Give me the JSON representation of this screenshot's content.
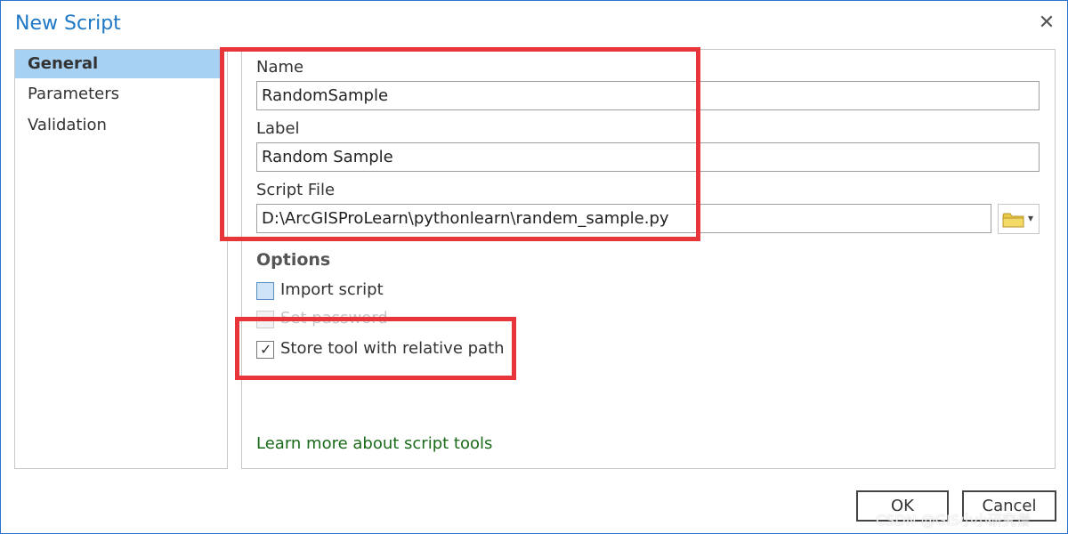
{
  "window": {
    "title": "New Script",
    "close_label": "✕"
  },
  "nav": {
    "items": [
      {
        "label": "General",
        "selected": true
      },
      {
        "label": "Parameters",
        "selected": false
      },
      {
        "label": "Validation",
        "selected": false
      }
    ]
  },
  "general": {
    "name_label": "Name",
    "name_value": "RandomSample",
    "label_label": "Label",
    "label_value": "Random Sample",
    "script_file_label": "Script File",
    "script_file_value": "D:\\ArcGISProLearn\\pythonlearn\\randem_sample.py",
    "browse_icon": "folder-icon",
    "browse_dropdown": "▾"
  },
  "options": {
    "heading": "Options",
    "import_script": {
      "label": "Import script",
      "checked": false
    },
    "set_password": {
      "label": "Set password",
      "checked": false,
      "disabled": true
    },
    "store_relative": {
      "label": "Store tool with relative path",
      "checked": true
    }
  },
  "check_mark": "✓",
  "learn_more": "Learn more about script tools",
  "buttons": {
    "ok": "OK",
    "cancel": "Cancel"
  },
  "watermark": "CSDN @GIS小小研究僧",
  "colors": {
    "accent": "#1f78c6",
    "selected_nav": "#a7d1f3",
    "highlight": "#e8353a",
    "link": "#1a6a1a"
  }
}
